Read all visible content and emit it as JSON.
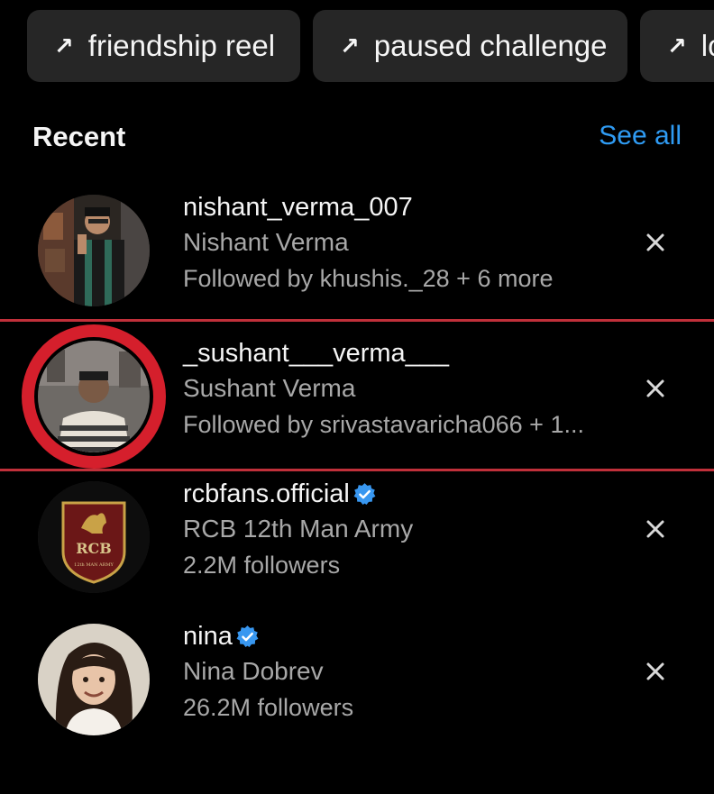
{
  "chips": [
    {
      "label": "friendship reel",
      "icon": "arrow-up-right-icon"
    },
    {
      "label": "paused challenge",
      "icon": "arrow-up-right-icon"
    },
    {
      "label": "lo",
      "icon": "arrow-up-right-icon"
    }
  ],
  "recent": {
    "title": "Recent",
    "see_all": "See all"
  },
  "accounts": [
    {
      "username": "nishant_verma_007",
      "full_name": "Nishant Verma",
      "meta": "Followed by khushis._28 + 6 more",
      "verified": false
    },
    {
      "username": "_sushant___verma___",
      "full_name": "Sushant Verma",
      "meta": "Followed by srivastavaricha066 + 1...",
      "verified": false
    },
    {
      "username": "rcbfans.official",
      "full_name": "RCB 12th Man Army",
      "meta": "2.2M followers",
      "verified": true
    },
    {
      "username": "nina",
      "full_name": "Nina Dobrev",
      "meta": "26.2M followers",
      "verified": true
    }
  ],
  "logo": {
    "rcb_text": "RCB",
    "rcb_subtext": "12th MAN ARMY"
  },
  "colors": {
    "background": "#000000",
    "chip": "#262626",
    "link": "#2f9bf3",
    "highlight": "#d51f2c",
    "verified": "#3897f0"
  }
}
